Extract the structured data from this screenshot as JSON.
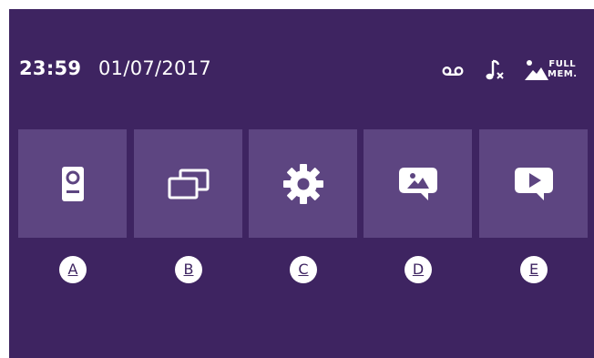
{
  "status": {
    "time": "23:59",
    "date": "01/07/2017",
    "icons": [
      "voicemail-icon",
      "ringtone-muted-icon",
      "memory-full-icon"
    ],
    "memory_full_line1": "FULL",
    "memory_full_line2": "MEM."
  },
  "menu": {
    "tiles": [
      {
        "icon": "intercom-icon",
        "label": "A"
      },
      {
        "icon": "monitors-icon",
        "label": "B"
      },
      {
        "icon": "gear-icon",
        "label": "C"
      },
      {
        "icon": "photo-message-icon",
        "label": "D"
      },
      {
        "icon": "video-message-icon",
        "label": "E"
      }
    ]
  },
  "colors": {
    "background": "#3e2461",
    "tile": "#5d4581",
    "foreground": "#ffffff"
  }
}
